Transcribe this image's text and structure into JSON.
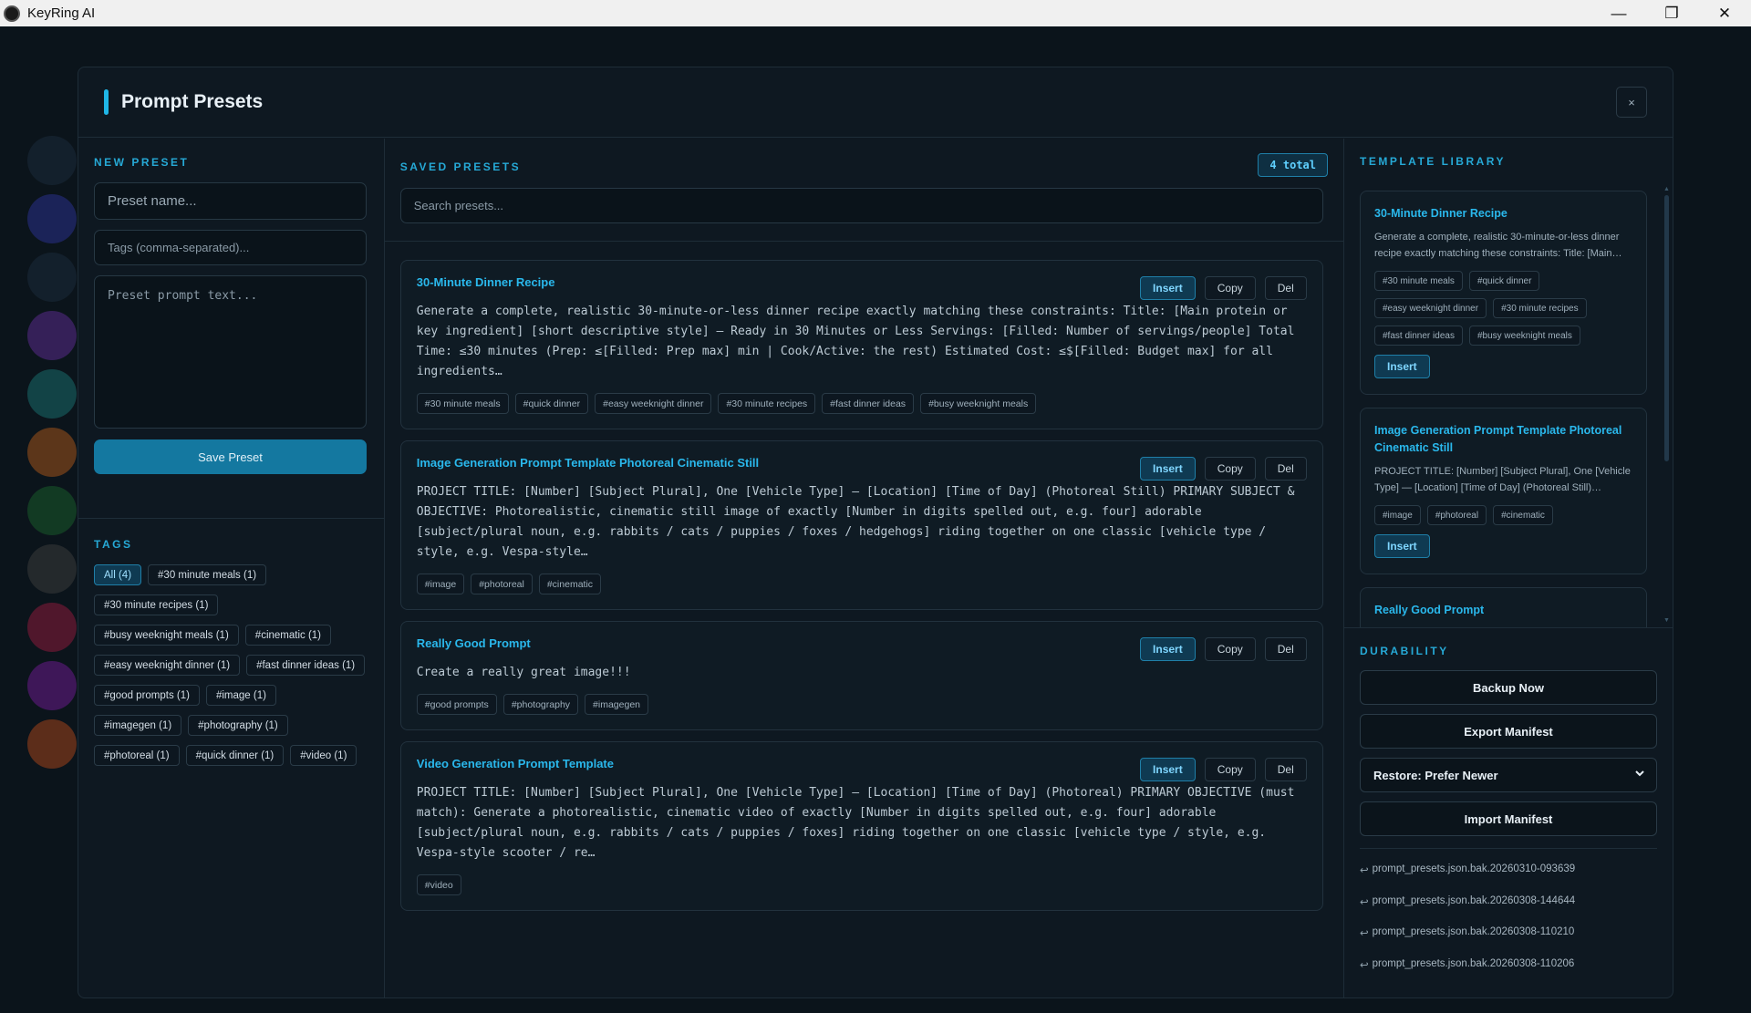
{
  "window": {
    "title": "KeyRing AI",
    "minimize": "—",
    "maximize": "❐",
    "close": "✕"
  },
  "modal": {
    "title": "Prompt Presets",
    "close": "×"
  },
  "new_preset": {
    "label": "NEW PRESET",
    "name_placeholder": "Preset name...",
    "tags_placeholder": "Tags (comma-separated)...",
    "text_placeholder": "Preset prompt text...",
    "save_label": "Save Preset"
  },
  "tags": {
    "label": "TAGS",
    "items": [
      "All (4)",
      "#30 minute meals (1)",
      "#30 minute recipes (1)",
      "#busy weeknight meals (1)",
      "#cinematic (1)",
      "#easy weeknight dinner (1)",
      "#fast dinner ideas (1)",
      "#good prompts (1)",
      "#image (1)",
      "#imagegen (1)",
      "#photography (1)",
      "#photoreal (1)",
      "#quick dinner (1)",
      "#video (1)"
    ]
  },
  "saved": {
    "label": "SAVED PRESETS",
    "total": "4 total",
    "search_placeholder": "Search presets...",
    "actions": {
      "insert": "Insert",
      "copy": "Copy",
      "del": "Del"
    },
    "presets": [
      {
        "title": "30-Minute Dinner Recipe",
        "body": "Generate a complete, realistic 30-minute-or-less dinner recipe exactly matching these constraints: Title: [Main protein or key ingredient] [short descriptive style] — Ready in 30 Minutes or Less Servings: [Filled: Number of servings/people] Total Time: ≤30 minutes (Prep: ≤[Filled: Prep max] min | Cook/Active: the rest) Estimated Cost: ≤$[Filled: Budget max] for all ingredients…",
        "tags": [
          "#30 minute meals",
          "#quick dinner",
          "#easy weeknight dinner",
          "#30 minute recipes",
          "#fast dinner ideas",
          "#busy weeknight meals"
        ]
      },
      {
        "title": "Image Generation Prompt Template Photoreal Cinematic Still",
        "body": "PROJECT TITLE: [Number] [Subject Plural], One [Vehicle Type] — [Location] [Time of Day] (Photoreal Still) PRIMARY SUBJECT & OBJECTIVE: Photorealistic, cinematic still image of exactly [Number in digits spelled out, e.g. four] adorable [subject/plural noun, e.g. rabbits / cats / puppies / foxes / hedgehogs] riding together on one classic [vehicle type / style, e.g. Vespa-style…",
        "tags": [
          "#image",
          "#photoreal",
          "#cinematic"
        ]
      },
      {
        "title": "Really Good Prompt",
        "body": "Create a really great image!!!",
        "tags": [
          "#good prompts",
          "#photography",
          "#imagegen"
        ]
      },
      {
        "title": "Video Generation Prompt Template",
        "body": "PROJECT TITLE: [Number] [Subject Plural], One [Vehicle Type] — [Location] [Time of Day] (Photoreal) PRIMARY OBJECTIVE (must match): Generate a photorealistic, cinematic video of exactly [Number in digits spelled out, e.g. four] adorable [subject/plural noun, e.g. rabbits / cats / puppies / foxes] riding together on one classic [vehicle type / style, e.g. Vespa-style scooter / re…",
        "tags": [
          "#video"
        ]
      }
    ]
  },
  "library": {
    "label": "TEMPLATE LIBRARY",
    "insert": "Insert",
    "items": [
      {
        "title": "30-Minute Dinner Recipe",
        "desc": "Generate a complete, realistic 30-minute-or-less dinner recipe exactly matching these constraints: Title: [Main…",
        "tags": [
          "#30 minute meals",
          "#quick dinner",
          "#easy weeknight dinner",
          "#30 minute recipes",
          "#fast dinner ideas",
          "#busy weeknight meals"
        ]
      },
      {
        "title": "Image Generation Prompt Template Photoreal Cinematic Still",
        "desc": "PROJECT TITLE: [Number] [Subject Plural], One [Vehicle Type] — [Location] [Time of Day] (Photoreal Still)…",
        "tags": [
          "#image",
          "#photoreal",
          "#cinematic"
        ]
      },
      {
        "title": "Really Good Prompt"
      }
    ]
  },
  "durability": {
    "label": "DURABILITY",
    "backup": "Backup Now",
    "export": "Export Manifest",
    "restore": "Restore: Prefer Newer",
    "import": "Import Manifest",
    "backups": [
      "prompt_presets.json.bak.20260310-093639",
      "prompt_presets.json.bak.20260308-144644",
      "prompt_presets.json.bak.20260308-110210",
      "prompt_presets.json.bak.20260308-110206"
    ]
  },
  "colors": {
    "accent": "#1fb6e6",
    "title_link": "#2ab8ec",
    "save": "#1478a0"
  }
}
